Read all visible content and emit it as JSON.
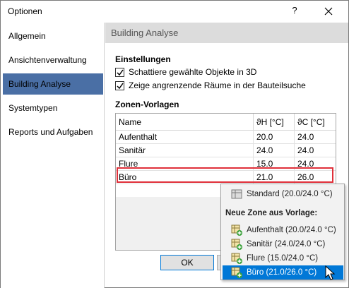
{
  "window": {
    "title": "Optionen",
    "help_glyph": "?"
  },
  "nav": {
    "items": [
      {
        "label": "Allgemein"
      },
      {
        "label": "Ansichtenverwaltung"
      },
      {
        "label": "Building Analyse"
      },
      {
        "label": "Systemtypen"
      },
      {
        "label": "Reports und Aufgaben"
      }
    ],
    "selected": "Building Analyse"
  },
  "panel": {
    "header": "Building Analyse",
    "settings_title": "Einstellungen",
    "checkboxes": [
      {
        "label": "Schattiere gewählte Objekte in 3D",
        "checked": true
      },
      {
        "label": "Zeige angrenzende Räume in der Bauteilsuche",
        "checked": true
      }
    ],
    "zones_title": "Zonen-Vorlagen",
    "table": {
      "headers": [
        "Name",
        "ϑH  [°C]",
        "ϑC  [°C]"
      ],
      "rows": [
        [
          "Aufenthalt",
          "20.0",
          "24.0"
        ],
        [
          "Sanitär",
          "24.0",
          "24.0"
        ],
        [
          "Flure",
          "15.0",
          "24.0"
        ],
        [
          "Büro",
          "21.0",
          "26.0"
        ]
      ],
      "highlighted_row": "Büro"
    }
  },
  "buttons": {
    "ok": "OK"
  },
  "context_menu": {
    "standard": "Standard (20.0/24.0 °C)",
    "heading": "Neue Zone aus Vorlage:",
    "items": [
      {
        "label": "Aufenthalt (20.0/24.0 °C)"
      },
      {
        "label": "Sanitär (24.0/24.0 °C)"
      },
      {
        "label": "Flure (15.0/24.0 °C)"
      },
      {
        "label": "Büro (21.0/26.0 °C)"
      }
    ],
    "hovered": "Büro (21.0/26.0 °C)"
  },
  "colors": {
    "selection": "#4a6fa5",
    "menu_hover": "#0078d7",
    "highlight_border": "#e0303a"
  }
}
